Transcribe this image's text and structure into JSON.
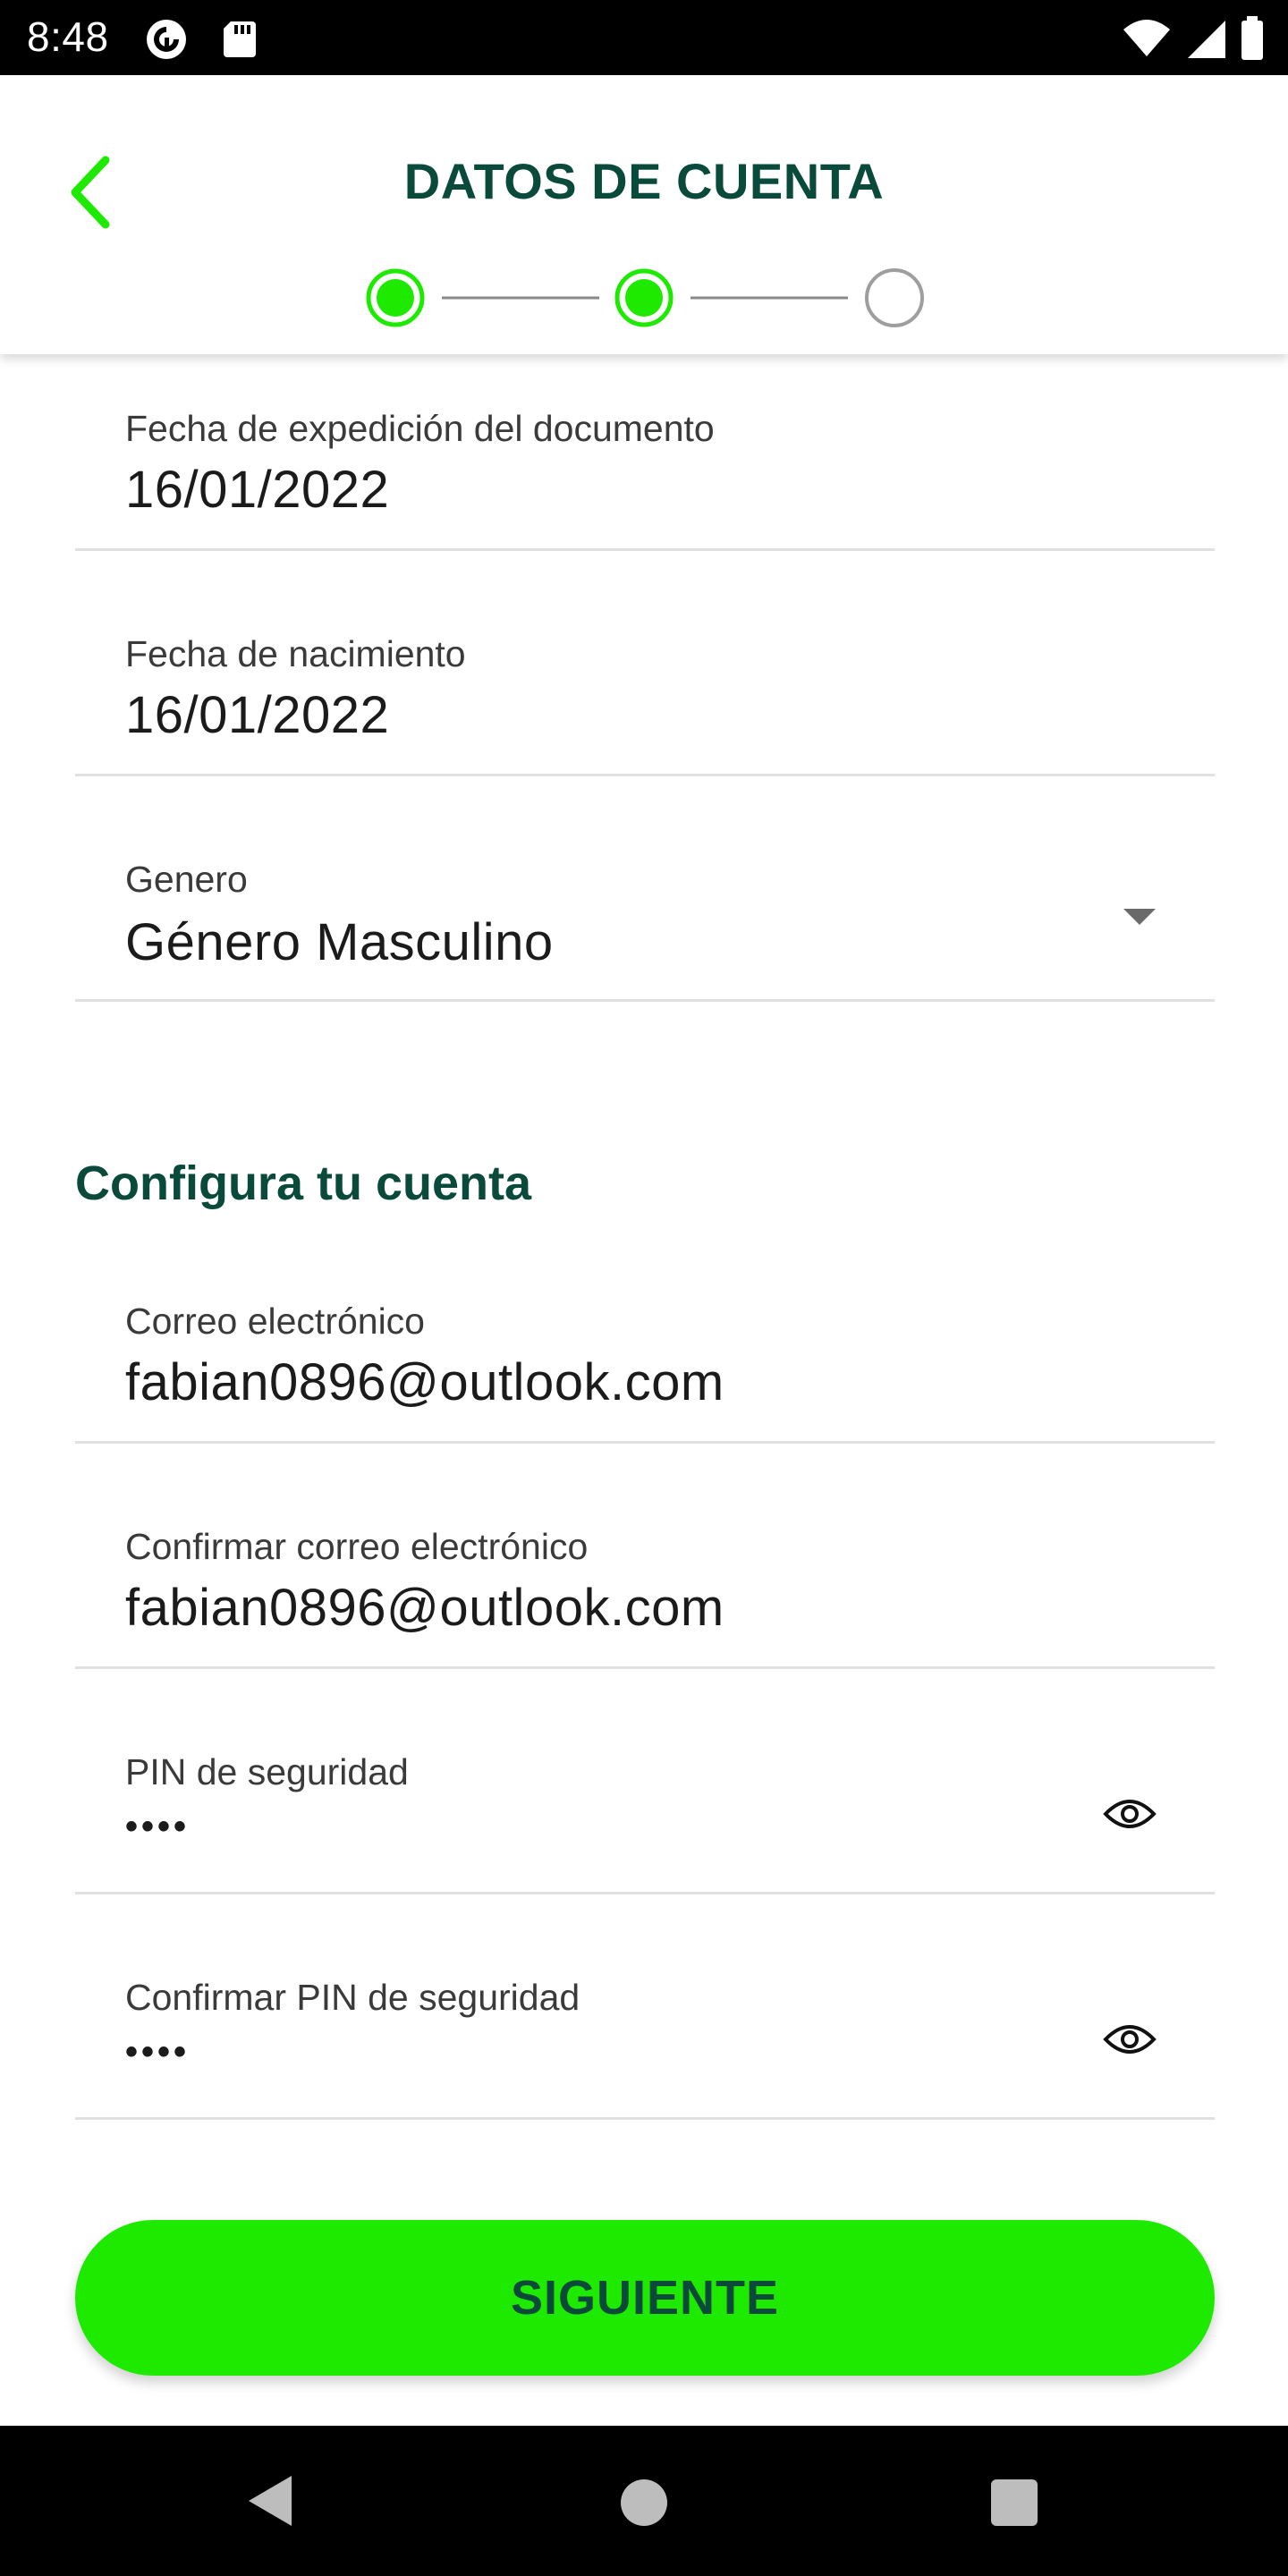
{
  "status_bar": {
    "time": "8:48",
    "icons": [
      "pocket-casts-icon",
      "sd-card-icon",
      "wifi-icon",
      "cell-signal-icon",
      "battery-icon"
    ]
  },
  "header": {
    "title": "DATOS DE CUENTA",
    "back_icon": "chevron-left-icon",
    "stepper": {
      "total_steps": 3,
      "completed_steps": 2,
      "active_color": "#1EEA00",
      "inactive_color": "#9E9E9E"
    }
  },
  "fields_personal": [
    {
      "label": "Fecha de expedición del documento",
      "value": "16/01/2022"
    },
    {
      "label": "Fecha de nacimiento",
      "value": "16/01/2022"
    },
    {
      "label": "Genero",
      "value": "Género Masculino",
      "control": "dropdown"
    }
  ],
  "account_section": {
    "title": "Configura tu cuenta",
    "fields": [
      {
        "label": "Correo electrónico",
        "value": "fabian0896@outlook.com"
      },
      {
        "label": "Confirmar correo electrónico",
        "value": "fabian0896@outlook.com"
      },
      {
        "label": "PIN de seguridad",
        "value": "••••",
        "control": "password",
        "toggle_icon": "eye-icon"
      },
      {
        "label": "Confirmar PIN de seguridad",
        "value": "••••",
        "control": "password",
        "toggle_icon": "eye-icon"
      }
    ]
  },
  "actions": {
    "next_label": "SIGUIENTE",
    "button_color": "#1EEA00"
  },
  "colors": {
    "brand_dark_green": "#0A4A3A",
    "accent_green": "#1EEA00"
  },
  "nav_bar": {
    "icons": [
      "nav-back-icon",
      "nav-home-icon",
      "nav-recents-icon"
    ]
  }
}
